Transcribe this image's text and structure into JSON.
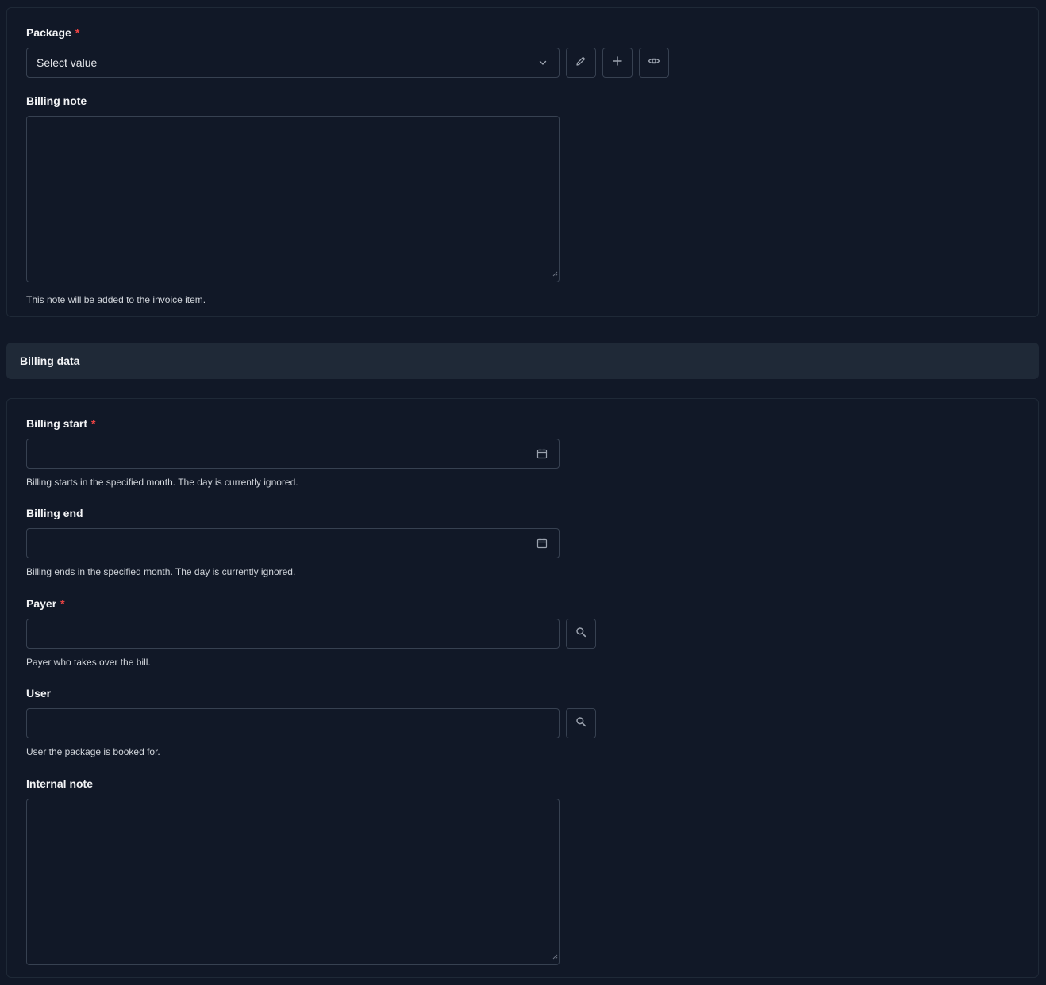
{
  "package_card": {
    "package": {
      "label": "Package",
      "required_mark": "*",
      "value": "Select value"
    },
    "billing_note": {
      "label": "Billing note",
      "hint": "This note will be added to the invoice item."
    }
  },
  "billing_section": {
    "title": "Billing data"
  },
  "billing_card": {
    "billing_start": {
      "label": "Billing start",
      "required_mark": "*",
      "hint": "Billing starts in the specified month. The day is currently ignored."
    },
    "billing_end": {
      "label": "Billing end",
      "hint": "Billing ends in the specified month. The day is currently ignored."
    },
    "payer": {
      "label": "Payer",
      "required_mark": "*",
      "hint": "Payer who takes over the bill."
    },
    "user": {
      "label": "User",
      "hint": "User the package is booked for."
    },
    "internal_note": {
      "label": "Internal note"
    }
  },
  "icons": {
    "edit": "pencil-icon",
    "add": "plus-icon",
    "view": "eye-icon",
    "dropdown": "chevron-down-icon",
    "date": "calendar-icon",
    "search": "search-icon"
  },
  "colors": {
    "background": "#111827",
    "border": "#374151",
    "header": "#1f2937",
    "required": "#ef4444"
  }
}
